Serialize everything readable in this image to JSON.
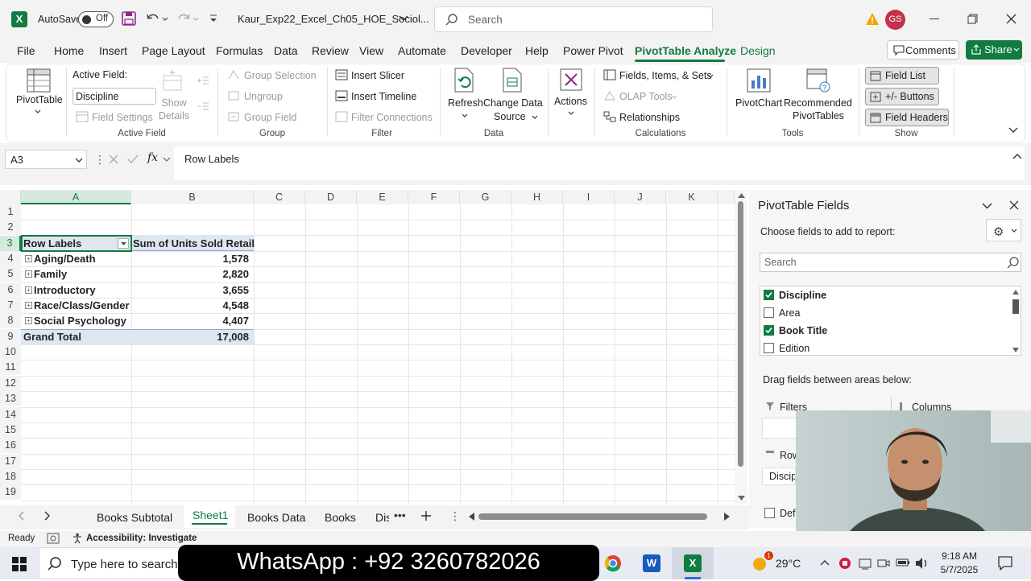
{
  "app": {
    "autosave_label": "AutoSave",
    "autosave_state": "Off",
    "filename": "Kaur_Exp22_Excel_Ch05_HOE_Sociol...",
    "search_placeholder": "Search",
    "user_initials": "GS"
  },
  "tabs": [
    "File",
    "Home",
    "Insert",
    "Page Layout",
    "Formulas",
    "Data",
    "Review",
    "View",
    "Automate",
    "Developer",
    "Help",
    "Power Pivot",
    "PivotTable Analyze",
    "Design"
  ],
  "active_tab": "PivotTable Analyze",
  "comments_label": "Comments",
  "share_label": "Share",
  "ribbon": {
    "pivottable": "PivotTable",
    "active_field_label": "Active Field:",
    "active_field_value": "Discipline",
    "field_settings": "Field Settings",
    "show_details": "Show Details",
    "show": "Show",
    "details": "Details",
    "group_selection": "Group Selection",
    "ungroup": "Ungroup",
    "group_field": "Group Field",
    "insert_slicer": "Insert Slicer",
    "insert_timeline": "Insert Timeline",
    "filter_connections": "Filter Connections",
    "refresh": "Refresh",
    "change_data": "Change Data",
    "source": "Source",
    "actions": "Actions",
    "fields_items_sets": "Fields, Items, & Sets",
    "olap_tools": "OLAP Tools",
    "relationships": "Relationships",
    "pivotchart": "PivotChart",
    "recommended": "Recommended",
    "pivottables": "PivotTables",
    "field_list": "Field List",
    "pm_buttons": "+/- Buttons",
    "field_headers": "Field Headers",
    "groups": {
      "active_field": "Active Field",
      "group": "Group",
      "filter": "Filter",
      "data": "Data",
      "calculations": "Calculations",
      "tools": "Tools",
      "show": "Show"
    }
  },
  "formula": {
    "name_box": "A3",
    "content": "Row Labels"
  },
  "columns": [
    "A",
    "B",
    "C",
    "D",
    "E",
    "F",
    "G",
    "H",
    "I",
    "J",
    "K"
  ],
  "rows": [
    "1",
    "2",
    "3",
    "4",
    "5",
    "6",
    "7",
    "8",
    "9",
    "10",
    "11",
    "12",
    "13",
    "14",
    "15",
    "16",
    "17",
    "18",
    "19"
  ],
  "pivot": {
    "header": [
      "Row Labels",
      "Sum of Units Sold Retail"
    ],
    "rows": [
      {
        "label": "Aging/Death",
        "value": "1,578"
      },
      {
        "label": "Family",
        "value": "2,820"
      },
      {
        "label": "Introductory",
        "value": "3,655"
      },
      {
        "label": "Race/Class/Gender",
        "value": "4,548"
      },
      {
        "label": "Social Psychology",
        "value": "4,407"
      }
    ],
    "total": {
      "label": "Grand Total",
      "value": "17,008"
    }
  },
  "panel": {
    "title": "PivotTable Fields",
    "subtitle": "Choose fields to add to report:",
    "search_placeholder": "Search",
    "fields": [
      {
        "name": "Discipline",
        "checked": true
      },
      {
        "name": "Area",
        "checked": false
      },
      {
        "name": "Book Title",
        "checked": true
      },
      {
        "name": "Edition",
        "checked": false
      }
    ],
    "drag_label": "Drag fields between areas below:",
    "filters": "Filters",
    "columns": "Columns",
    "rows": "Rows",
    "rows_item": "Discipline",
    "defer": "Defer Layout Update"
  },
  "sheets": [
    "Books Subtotal",
    "Sheet1",
    "Books Data",
    "Books",
    "Dis"
  ],
  "active_sheet": "Sheet1",
  "status": {
    "ready": "Ready",
    "accessibility": "Accessibility: Investigate"
  },
  "taskbar": {
    "search_placeholder": "Type here to search",
    "banner": "WhatsApp : +92 3260782026",
    "temperature": "29°C",
    "time": "9:18 AM",
    "date": "5/7/2025",
    "weather_badge": "1"
  }
}
